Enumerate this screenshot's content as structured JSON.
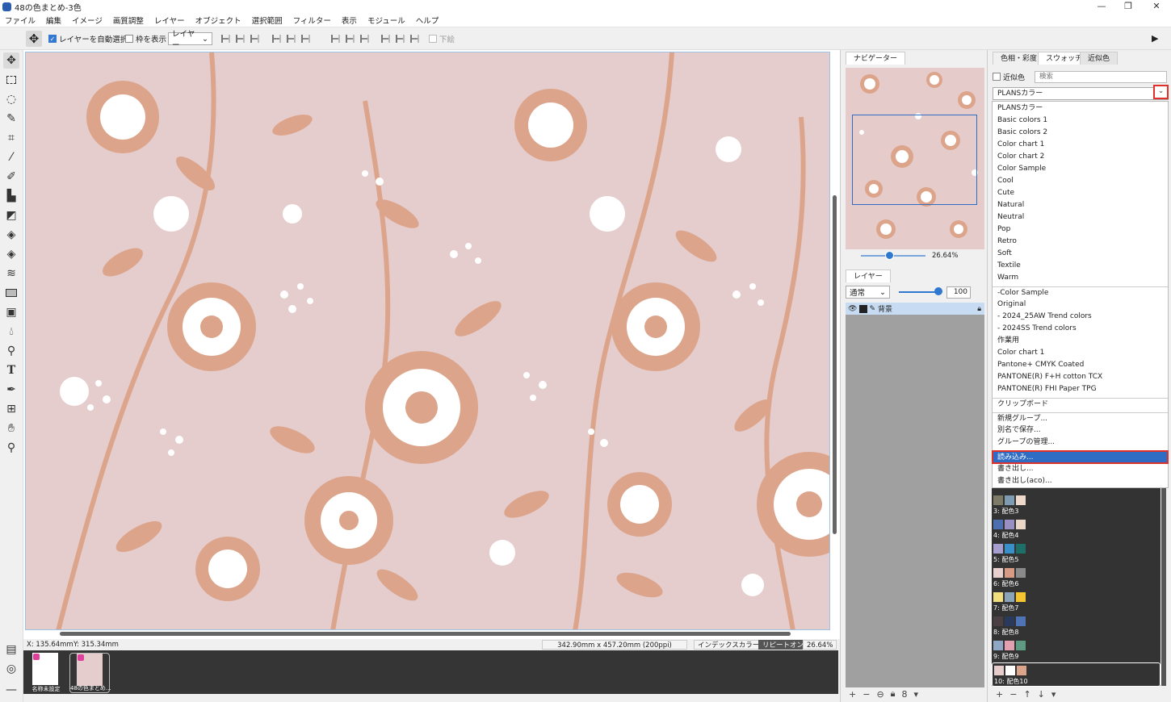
{
  "window": {
    "title": "48の色まとめ-3色",
    "controls": [
      "—",
      "❐",
      "✕"
    ]
  },
  "menubar": [
    "ファイル",
    "編集",
    "イメージ",
    "画質調整",
    "レイヤー",
    "オブジェクト",
    "選択範囲",
    "フィルター",
    "表示",
    "モジュール",
    "ヘルプ"
  ],
  "options": {
    "auto_select_label": "レイヤーを自動選択",
    "auto_select_checked": true,
    "show_bounds_label": "枠を表示",
    "show_bounds_checked": false,
    "target_select": "レイヤー",
    "below_label": "下絵"
  },
  "status": {
    "x": "X: 135.64mm",
    "y": "Y: 315.34mm",
    "doc_size": "342.90mm x 457.20mm (200ppi)",
    "color_mode": "インデックスカラー",
    "repeat": "リピートオン",
    "zoom": "26.64%"
  },
  "documents": [
    {
      "label": "名称未設定",
      "selected": false
    },
    {
      "label": "48の色まとめ...",
      "selected": true
    }
  ],
  "navigator": {
    "tab": "ナビゲーター",
    "zoom": "26.64%"
  },
  "layers": {
    "tab": "レイヤー",
    "blend_mode": "通常",
    "opacity": "100",
    "items": [
      {
        "name": "背景",
        "locked": true
      }
    ]
  },
  "right_panel": {
    "tabs": [
      "色相・彩度",
      "スウォッチ",
      "近似色"
    ],
    "active_tab": 1,
    "similar_label": "近似色",
    "search_placeholder": "検索",
    "dropdown_value": "PLANSカラー",
    "menu_group1": [
      "PLANSカラー",
      "Basic colors 1",
      "Basic colors 2",
      "Color chart 1",
      "Color chart 2",
      "Color Sample",
      "Cool",
      "Cute",
      "Natural",
      "Neutral",
      "Pop",
      "Retro",
      "Soft",
      "Textile",
      "Warm"
    ],
    "menu_group2": [
      "-Color Sample",
      "Original",
      " - 2024_25AW Trend colors",
      " - 2024SS Trend colors",
      "作業用",
      "Color chart 1",
      "Pantone+ CMYK Coated",
      "PANTONE(R) F+H cotton TCX",
      "PANTONE(R) FHI Paper TPG"
    ],
    "menu_group3": [
      "クリップボード"
    ],
    "menu_group4": [
      "新規グループ...",
      "別名で保存...",
      "グループの管理..."
    ],
    "menu_group5": [
      "読み込み...",
      "書き出し...",
      "書き出し(aco)..."
    ],
    "highlighted": "読み込み..."
  },
  "swatches": [
    {
      "label": "3: 配色3",
      "colors": [
        "#7d7b67",
        "#7f9bb1",
        "#ecd9cc"
      ]
    },
    {
      "label": "4: 配色4",
      "colors": [
        "#4d6fb0",
        "#9a8fc2",
        "#ead6c9"
      ]
    },
    {
      "label": "5: 配色5",
      "colors": [
        "#a79ed0",
        "#3a8fc9",
        "#1d6f67"
      ]
    },
    {
      "label": "6: 配色6",
      "colors": [
        "#e8d0cf",
        "#d69a85",
        "#8a8a8a"
      ]
    },
    {
      "label": "7: 配色7",
      "colors": [
        "#f1de7e",
        "#8ba4b8",
        "#f2c531"
      ]
    },
    {
      "label": "8: 配色8",
      "colors": [
        "#4a4044",
        "#2a3a5c",
        "#4f74b5"
      ]
    },
    {
      "label": "9: 配色9",
      "colors": [
        "#8fa6c4",
        "#e2a1b0",
        "#5f9a82"
      ]
    },
    {
      "label": "10: 配色10",
      "colors": [
        "#e7cccc",
        "#ffffff",
        "#dca58b"
      ]
    }
  ],
  "colors": {
    "canvas_bg": "#e5cccd",
    "flower_tan": "#dca58b",
    "flower_white": "#ffffff",
    "accent": "#2f6dc4",
    "highlight_border": "#e0302a"
  }
}
